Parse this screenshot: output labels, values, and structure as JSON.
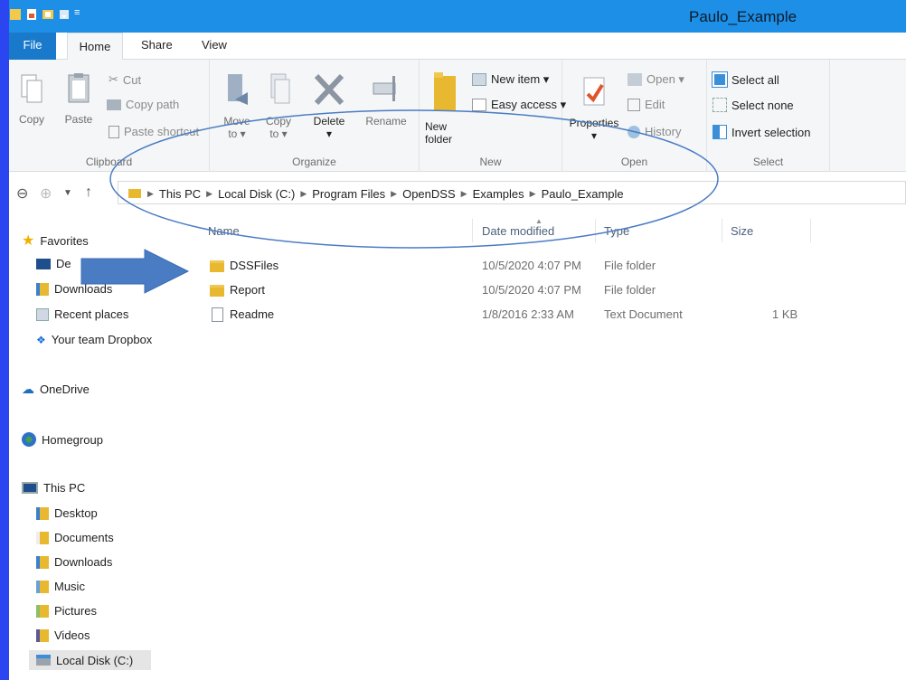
{
  "window": {
    "title": "Paulo_Example"
  },
  "tabs": [
    "File",
    "Home",
    "Share",
    "View"
  ],
  "ribbon": {
    "clipboard": {
      "label": "Clipboard",
      "copy": "Copy",
      "paste": "Paste",
      "cut": "Cut",
      "copy_path": "Copy path",
      "paste_shortcut": "Paste shortcut"
    },
    "organize": {
      "label": "Organize",
      "move_to_1": "Move",
      "move_to_2": "to ▾",
      "copy_to_1": "Copy",
      "copy_to_2": "to ▾",
      "delete": "Delete",
      "delete_caret": "▾",
      "rename": "Rename"
    },
    "new": {
      "label": "New",
      "new_folder_1": "New",
      "new_folder_2": "folder",
      "new_item": "New item ▾",
      "easy_access": "Easy access ▾"
    },
    "open": {
      "label": "Open",
      "properties": "Properties",
      "properties_caret": "▾",
      "open": "Open ▾",
      "edit": "Edit",
      "history": "History"
    },
    "select": {
      "label": "Select",
      "select_all": "Select all",
      "select_none": "Select none",
      "invert": "Invert selection"
    }
  },
  "address": {
    "crumbs": [
      "This PC",
      "Local Disk (C:)",
      "Program Files",
      "OpenDSS",
      "Examples",
      "Paulo_Example"
    ]
  },
  "nav": {
    "favorites": "Favorites",
    "fav_items": [
      "De",
      "Downloads",
      "Recent places",
      "Your team Dropbox"
    ],
    "onedrive": "OneDrive",
    "homegroup": "Homegroup",
    "thispc": "This PC",
    "pc_items": [
      "Desktop",
      "Documents",
      "Downloads",
      "Music",
      "Pictures",
      "Videos",
      "Local Disk (C:)"
    ]
  },
  "columns": {
    "name": "Name",
    "date": "Date modified",
    "type": "Type",
    "size": "Size"
  },
  "files": [
    {
      "name": "DSSFiles",
      "date": "10/5/2020 4:07 PM",
      "type": "File folder",
      "size": "",
      "icon": "folder-icon"
    },
    {
      "name": "Report",
      "date": "10/5/2020 4:07 PM",
      "type": "File folder",
      "size": "",
      "icon": "folder-icon"
    },
    {
      "name": "Readme",
      "date": "1/8/2016 2:33 AM",
      "type": "Text Document",
      "size": "1 KB",
      "icon": "text-document-icon"
    }
  ],
  "colors": {
    "titlebar": "#1e8fe6",
    "file_tab": "#1979ca",
    "border_bg": "#2b46f0",
    "annotation": "#4a7cc4"
  }
}
